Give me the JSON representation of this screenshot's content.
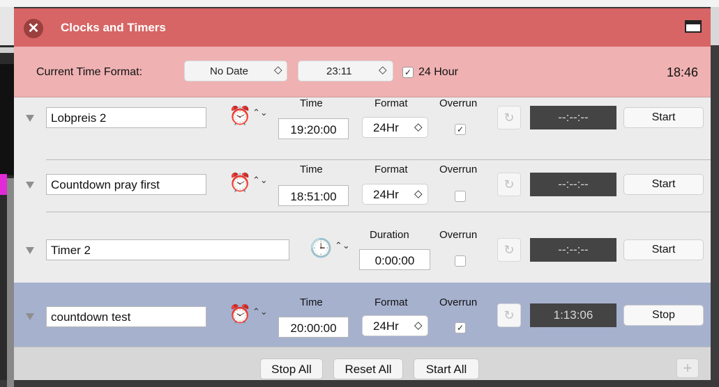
{
  "window": {
    "title": "Clocks and Timers"
  },
  "format_bar": {
    "label": "Current Time Format:",
    "date_format": "No Date",
    "time_format": "23:11",
    "hour24_checked": true,
    "hour24_label": "24 Hour",
    "current_time": "18:46"
  },
  "rows": [
    {
      "name": "Lobpreis 2",
      "col1_header": "Time",
      "time": "19:20:00",
      "format_header": "Format",
      "format": "24Hr",
      "overrun_header": "Overrun",
      "overrun": true,
      "display": "--:--:--",
      "action": "Start"
    },
    {
      "name": "Countdown pray first",
      "col1_header": "Time",
      "time": "18:51:00",
      "format_header": "Format",
      "format": "24Hr",
      "overrun_header": "Overrun",
      "overrun": false,
      "display": "--:--:--",
      "action": "Start"
    },
    {
      "name": "Timer 2",
      "col1_header": "Duration",
      "time": "0:00:00",
      "overrun_header": "Overrun",
      "overrun": false,
      "display": "--:--:--",
      "action": "Start"
    },
    {
      "name": "countdown test",
      "col1_header": "Time",
      "time": "20:00:00",
      "format_header": "Format",
      "format": "24Hr",
      "overrun_header": "Overrun",
      "overrun": true,
      "display": "1:13:06",
      "action": "Stop"
    }
  ],
  "footer": {
    "stop_all": "Stop All",
    "reset_all": "Reset All",
    "start_all": "Start All",
    "add": "+"
  },
  "glyphs": {
    "check": "✓",
    "updown": "⌃⌄",
    "select_arrow": "◇",
    "reset": "↻",
    "close": "✕",
    "alarm": "⏰",
    "clock": "🕒"
  },
  "colors": {
    "titlebar": "#d76565",
    "format_bar": "#efb1b2",
    "active_row": "#a6b1ce",
    "timer_display": "#444444"
  }
}
